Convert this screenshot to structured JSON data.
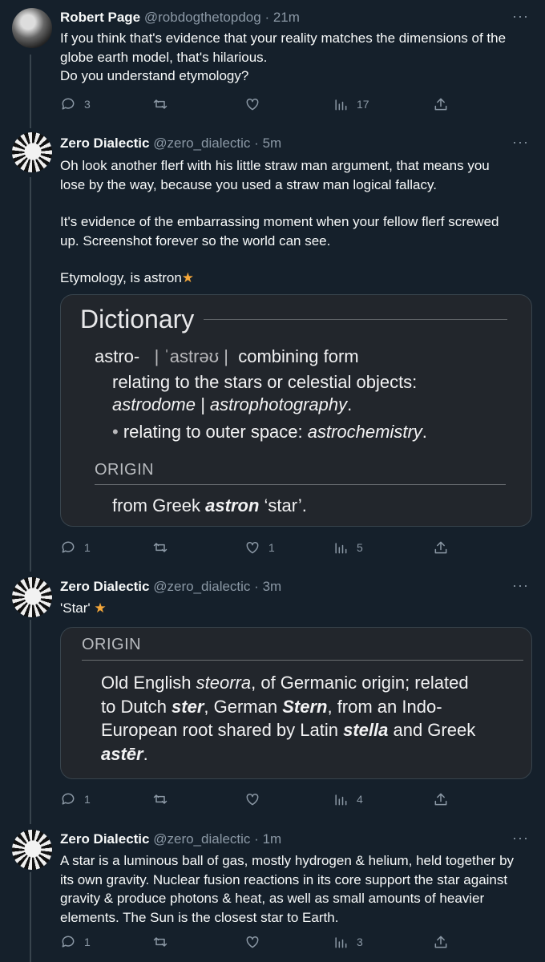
{
  "tweets": [
    {
      "name": "Robert Page",
      "handle": "@robdogthetopdog",
      "time": "21m",
      "lines": [
        "If you think that's evidence that your reality matches the dimensions of the",
        "globe earth model, that's hilarious.",
        "Do you understand etymology?"
      ],
      "replies": "3",
      "retweets": "",
      "likes": "",
      "views": "17"
    },
    {
      "name": "Zero Dialectic",
      "handle": "@zero_dialectic",
      "time": "5m",
      "lines": [
        "Oh look another flerf with his little straw man argument, that means you",
        "lose by the way, because you used a straw man logical fallacy.",
        "It's evidence of the embarrassing moment when your fellow flerf screwed",
        "up. Screenshot forever so the world can see.",
        "Etymology, is astron"
      ],
      "emoji": "★",
      "replies": "1",
      "retweets": "",
      "likes": "1",
      "views": "5"
    },
    {
      "name": "Zero Dialectic",
      "handle": "@zero_dialectic",
      "time": "3m",
      "lines": [
        "'Star'"
      ],
      "emoji": "★",
      "replies": "1",
      "retweets": "",
      "likes": "",
      "views": "4"
    },
    {
      "name": "Zero Dialectic",
      "handle": "@zero_dialectic",
      "time": "1m",
      "lines": [
        "A star is a luminous ball of gas, mostly hydrogen & helium, held together by",
        "its own gravity. Nuclear fusion reactions in its core support the star against",
        "gravity & produce photons & heat, as well as small amounts of heavier",
        "elements. The Sun is the closest star to Earth."
      ],
      "replies": "1",
      "retweets": "",
      "likes": "",
      "views": "3"
    }
  ],
  "dictionary_card": {
    "title": "Dictionary",
    "headword": "astro-",
    "pronunciation": "| ˈastrəʊ |",
    "pos": "combining form",
    "def1": "relating to the stars or celestial objects:",
    "def1_examples": "astrodome | astrophotography",
    "def1_end": ".",
    "bullet": "•",
    "def2": "relating to outer space: ",
    "def2_example": "astrochemistry",
    "def2_end": ".",
    "origin_heading": "ORIGIN",
    "origin_pre": "from Greek ",
    "origin_word": "astron",
    "origin_post": " ‘star’."
  },
  "origin_card": {
    "heading": "ORIGIN",
    "l1_a": "Old English ",
    "l1_b": "steorra",
    "l1_c": ", of Germanic origin; related",
    "l2_a": "to Dutch ",
    "l2_b": "ster",
    "l2_c": ", German ",
    "l2_d": "Stern",
    "l2_e": ", from an Indo-",
    "l3_a": "European root shared by Latin ",
    "l3_b": "stella",
    "l3_c": " and Greek",
    "l4_a": "astēr",
    "l4_b": "."
  },
  "ui": {
    "separator": "·",
    "more": "···"
  },
  "colors": {
    "background": "#15202b",
    "secondary_text": "#8b98a5",
    "emoji_star": "#f4a73a"
  }
}
